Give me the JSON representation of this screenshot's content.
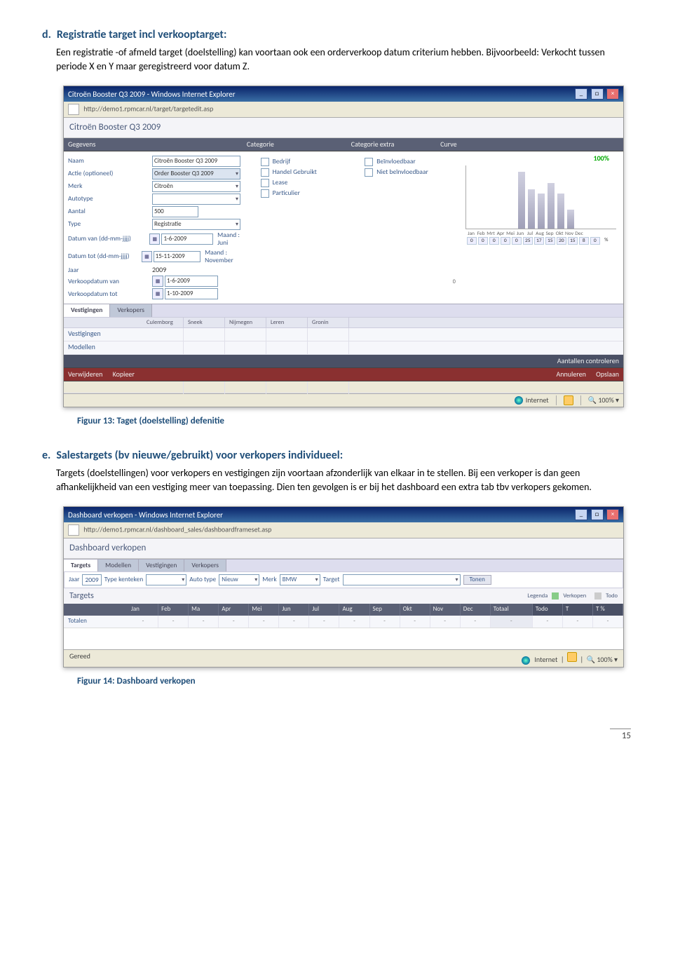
{
  "sectionD": {
    "letter": "d.",
    "title": "Registratie target incl verkooptarget:",
    "body": "Een registratie -of afmeld target (doelstelling) kan voortaan ook een orderverkoop datum criterium hebben. Bijvoorbeeld: Verkocht tussen periode X en Y maar geregistreerd voor datum Z."
  },
  "fig13": {
    "caption": "Figuur 13: Taget (doelstelling) defenitie",
    "windowTitle": "Citroën Booster Q3 2009 - Windows Internet Explorer",
    "url": "http://demo1.rpmcar.nl/target/targetedit.asp",
    "pageTitle": "Citroën Booster Q3 2009",
    "headerCols": [
      "Gegevens",
      "Categorie",
      "Categorie extra",
      "Curve"
    ],
    "labels": {
      "naam": "Naam",
      "actie": "Actie (optioneel)",
      "merk": "Merk",
      "autotype": "Autotype",
      "aantal": "Aantal",
      "type": "Type",
      "dvan": "Datum van (dd-mm-jjjj)",
      "dtot": "Datum tot (dd-mm-jjjj)",
      "jaar": "Jaar",
      "vvan": "Verkoopdatum van",
      "vtot": "Verkoopdatum tot"
    },
    "values": {
      "naam": "Citroën Booster Q3 2009",
      "actie": "Order Booster Q3 2009",
      "merk": "Citroën",
      "autotype": "",
      "aantal": "500",
      "type": "Registratie",
      "dvan": "1-6-2009",
      "dvanMaand": "Maand : Juni",
      "dtot": "15-11-2009",
      "dtotMaand": "Maand : November",
      "jaar": "2009",
      "vvan": "1-6-2009",
      "vtot": "1-10-2009"
    },
    "categorie": [
      "Bedrijf",
      "Handel Gebruikt",
      "Lease",
      "Particulier"
    ],
    "categorieExtra": [
      "Beïnvloedbaar",
      "Niet beïnvloedbaar"
    ],
    "curvePct": "100%",
    "months": [
      "Jan",
      "Feb",
      "Mrt",
      "Apr",
      "Mei",
      "Jun",
      "Jul",
      "Aug",
      "Sep",
      "Okt",
      "Nov",
      "Dec"
    ],
    "monthVals": [
      "0",
      "0",
      "0",
      "0",
      "0",
      "25",
      "17",
      "15",
      "20",
      "15",
      "8",
      "0"
    ],
    "tabs": [
      "Vestigingen",
      "Verkopers"
    ],
    "gridCols": [
      "Culemborg",
      "Sneek",
      "Nijmegen",
      "Leren",
      "Gronin"
    ],
    "gridRows": [
      "Vestigingen",
      "Modellen"
    ],
    "rightDark": "Aantallen controleren",
    "bottomLeft": [
      "Verwijderen",
      "Kopieer"
    ],
    "bottomRight": [
      "Annuleren",
      "Opslaan"
    ],
    "status": {
      "net": "Internet",
      "zoom": "100%"
    }
  },
  "sectionE": {
    "letter": "e.",
    "title": "Salestargets (bv nieuwe/gebruikt) voor verkopers individueel:",
    "body": "Targets (doelstellingen) voor verkopers en vestigingen zijn voortaan afzonderlijk van elkaar in te stellen. Bij een verkoper is dan geen afhankelijkheid van een vestiging meer van toepassing. Dien ten gevolgen is er bij het dashboard een extra tab tbv verkopers gekomen."
  },
  "fig14": {
    "caption": "Figuur 14: Dashboard verkopen",
    "windowTitle": "Dashboard verkopen - Windows Internet Explorer",
    "url": "http://demo1.rpmcar.nl/dashboard_sales/dashboardframeset.asp",
    "pageTitle": "Dashboard verkopen",
    "tabs": [
      "Targets",
      "Modellen",
      "Vestigingen",
      "Verkopers"
    ],
    "filters": {
      "jaar": "Jaar",
      "jaarVal": "2009",
      "typeKenteken": "Type kenteken",
      "typeKentekenVal": "",
      "autotype": "Auto type",
      "autotypeVal": "Nieuw",
      "merk": "Merk",
      "merkVal": "BMW",
      "target": "Target",
      "targetVal": "",
      "tonen": "Tonen"
    },
    "subtitle": "Targets",
    "legendLabel": "Legenda",
    "legend": [
      {
        "label": "Verkopen",
        "color": "#8c8"
      },
      {
        "label": "Todo",
        "color": "#ccc"
      }
    ],
    "months": [
      "Jan",
      "Feb",
      "Ma",
      "Apr",
      "Mei",
      "Jun",
      "Jul",
      "Aug",
      "Sep",
      "Okt",
      "Nov",
      "Dec",
      "Totaal"
    ],
    "todoCols": [
      "Todo",
      "T",
      "T %"
    ],
    "row": {
      "label": "Totalen",
      "vals": [
        "-",
        "-",
        "-",
        "-",
        "-",
        "-",
        "-",
        "-",
        "-",
        "-",
        "-",
        "-",
        "-",
        "-",
        "-",
        "-"
      ]
    },
    "status": {
      "gereed": "Gereed",
      "net": "Internet",
      "zoom": "100%"
    }
  },
  "pageNumber": "15"
}
